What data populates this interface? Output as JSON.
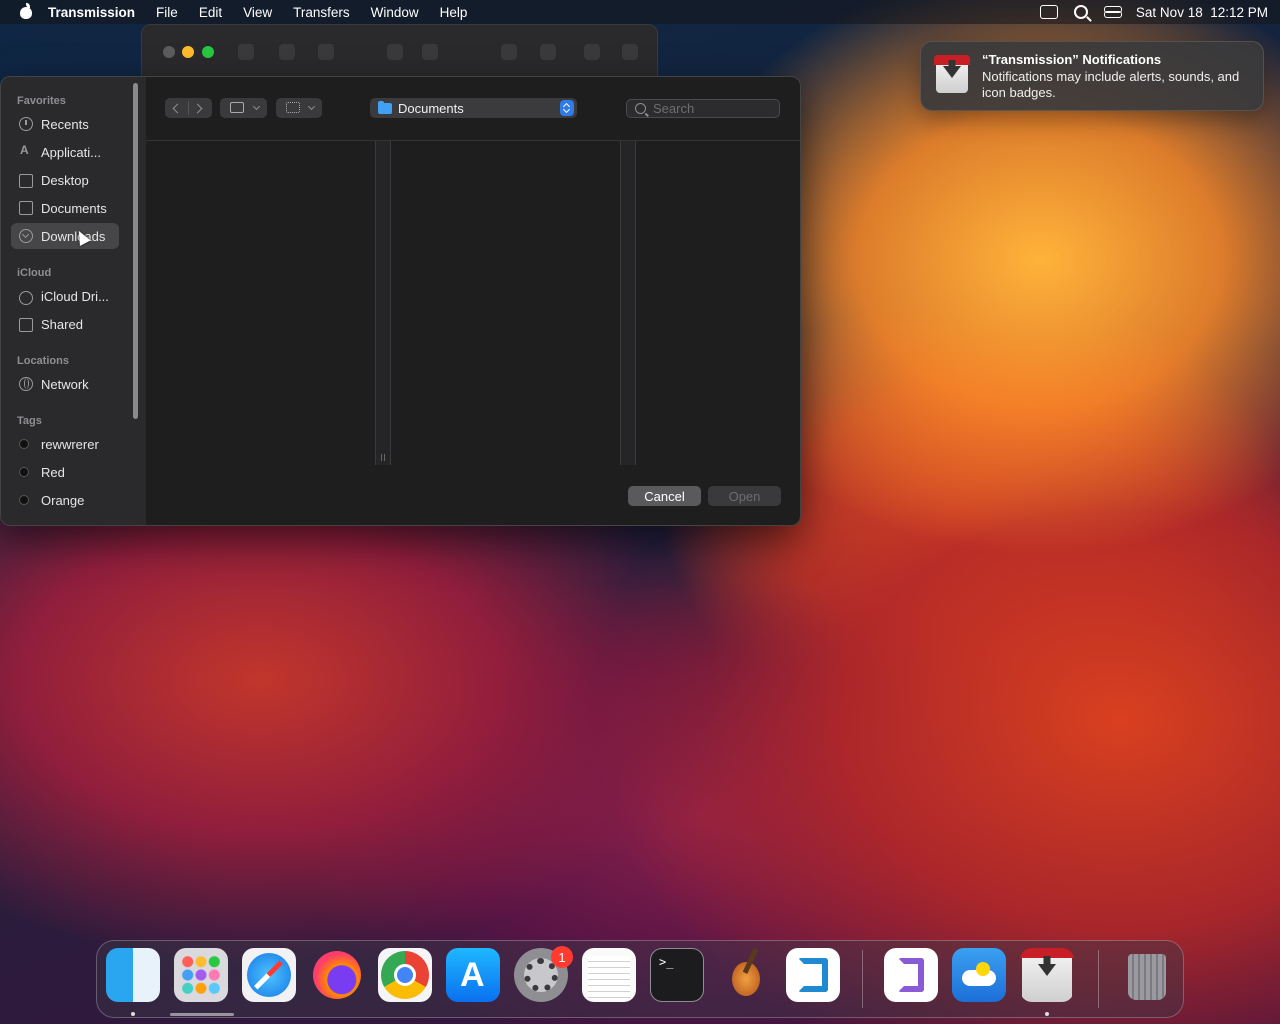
{
  "menubar": {
    "app_name": "Transmission",
    "menus": [
      "File",
      "Edit",
      "View",
      "Transfers",
      "Window",
      "Help"
    ],
    "datetime": "Sat Nov 18  12:12 PM",
    "icons": [
      "apple-icon",
      "screen-mirroring-icon",
      "spotlight-icon",
      "control-center-icon"
    ]
  },
  "dialog": {
    "sidebar": {
      "favorites_header": "Favorites",
      "favorites": [
        "Recents",
        "Applicati...",
        "Desktop",
        "Documents",
        "Downloads"
      ],
      "selected": "Downloads",
      "icloud_header": "iCloud",
      "icloud": [
        "iCloud Dri...",
        "Shared"
      ],
      "locations_header": "Locations",
      "locations": [
        "Network"
      ],
      "tags_header": "Tags",
      "tags": [
        "rewwrerer",
        "Red",
        "Orange"
      ]
    },
    "location": "Documents",
    "search": {
      "placeholder": "Search",
      "value": ""
    },
    "cancel_label": "Cancel",
    "open_label": "Open"
  },
  "notification": {
    "title": "“Transmission” Notifications",
    "body": "Notifications may include alerts, sounds, and icon badges."
  },
  "dock": {
    "apps": [
      "Finder",
      "Launchpad",
      "Safari",
      "Firefox",
      "Chrome",
      "App Store",
      "System Settings",
      "TextEdit",
      "Terminal",
      "GarageBand",
      "Visual Studio Code",
      "Visual Studio",
      "Weather",
      "Transmission",
      "Trash"
    ],
    "system_settings_badge": "1"
  },
  "colors": {
    "accent": "#2f7ce8",
    "close": "#ff5f57",
    "minimize": "#febc2e",
    "zoom": "#28c840",
    "badge": "#ff3b30"
  }
}
